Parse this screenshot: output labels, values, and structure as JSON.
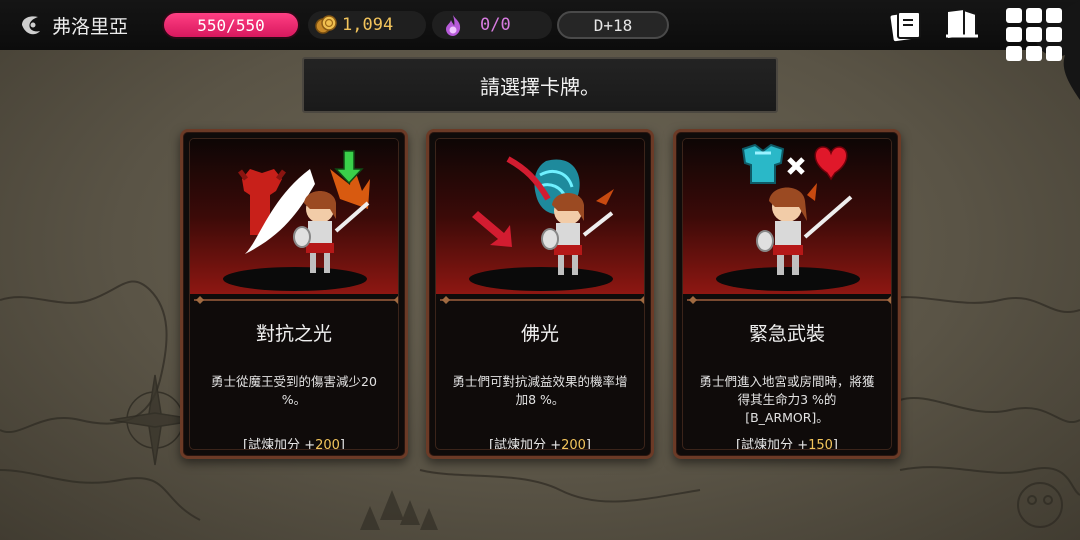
{
  "header": {
    "region_name": "弗洛里亞",
    "hp": "550/550",
    "gold": "1,094",
    "souls": "0/0",
    "day": "D+18",
    "colors": {
      "hp": "#e8206a",
      "gold": "#f2c45c",
      "soul": "#d77be0"
    },
    "icons": [
      "region-emblem-icon",
      "gold-coin-icon",
      "soul-flame-icon",
      "card-deck-icon",
      "codex-book-icon",
      "menu-grid-icon"
    ]
  },
  "banner": {
    "title": "請選擇卡牌。"
  },
  "cards": [
    {
      "name": "對抗之光",
      "desc": "勇士從魔王受到的傷害減少20 %。",
      "score_open": "[試煉加分 +",
      "score_value": "200",
      "score_close": "]",
      "art_icons": [
        "demon-horn-icon",
        "light-slash-icon",
        "down-arrow-icon",
        "hero-girl-sprite"
      ]
    },
    {
      "name": "佛光",
      "desc": "勇士們可對抗減益效果的機率增加8 %。",
      "score_open": "[試煉加分 +",
      "score_value": "200",
      "score_close": "]",
      "art_icons": [
        "down-arrow-icon",
        "cyan-shield-icon",
        "hero-girl-sprite"
      ]
    },
    {
      "name": "緊急武裝",
      "desc": "勇士們進入地宮或房間時，將獲得其生命力3 %的[B_ARMOR]。",
      "score_open": "[試煉加分 +",
      "score_value": "150",
      "score_close": "]",
      "art_icons": [
        "armor-icon",
        "cross-icon",
        "heart-icon",
        "hero-girl-sprite"
      ]
    }
  ]
}
